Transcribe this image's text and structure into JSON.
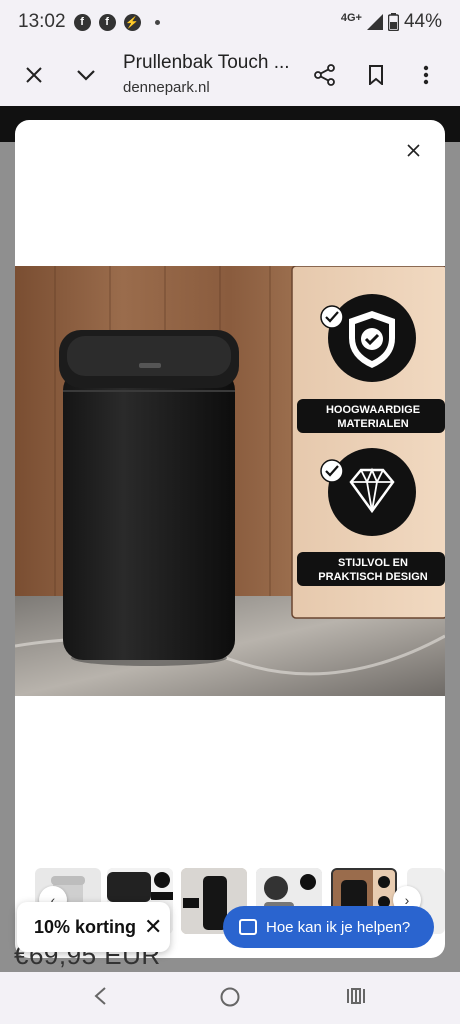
{
  "status_bar": {
    "time": "13:02",
    "network": "4G+",
    "battery": "44%",
    "notification_icons": [
      "facebook-icon",
      "facebook-icon",
      "messenger-icon"
    ]
  },
  "browser": {
    "title": "Prullenbak Touch ...",
    "domain": "dennepark.nl"
  },
  "product_image": {
    "badge_1": "HOOGWAARDIGE\nMATERIALEN",
    "badge_1_line1": "HOOGWAARDIGE",
    "badge_1_line2": "MATERIALEN",
    "badge_2_line1": "STIJLVOL EN",
    "badge_2_line2": "PRAKTISCH DESIGN"
  },
  "price_peek": "€69,95 EUR",
  "discount_chip": {
    "label": "10% korting",
    "close": "✕"
  },
  "help_button": {
    "label": "Hoe kan ik je helpen?"
  },
  "modal": {
    "close": "✕"
  }
}
